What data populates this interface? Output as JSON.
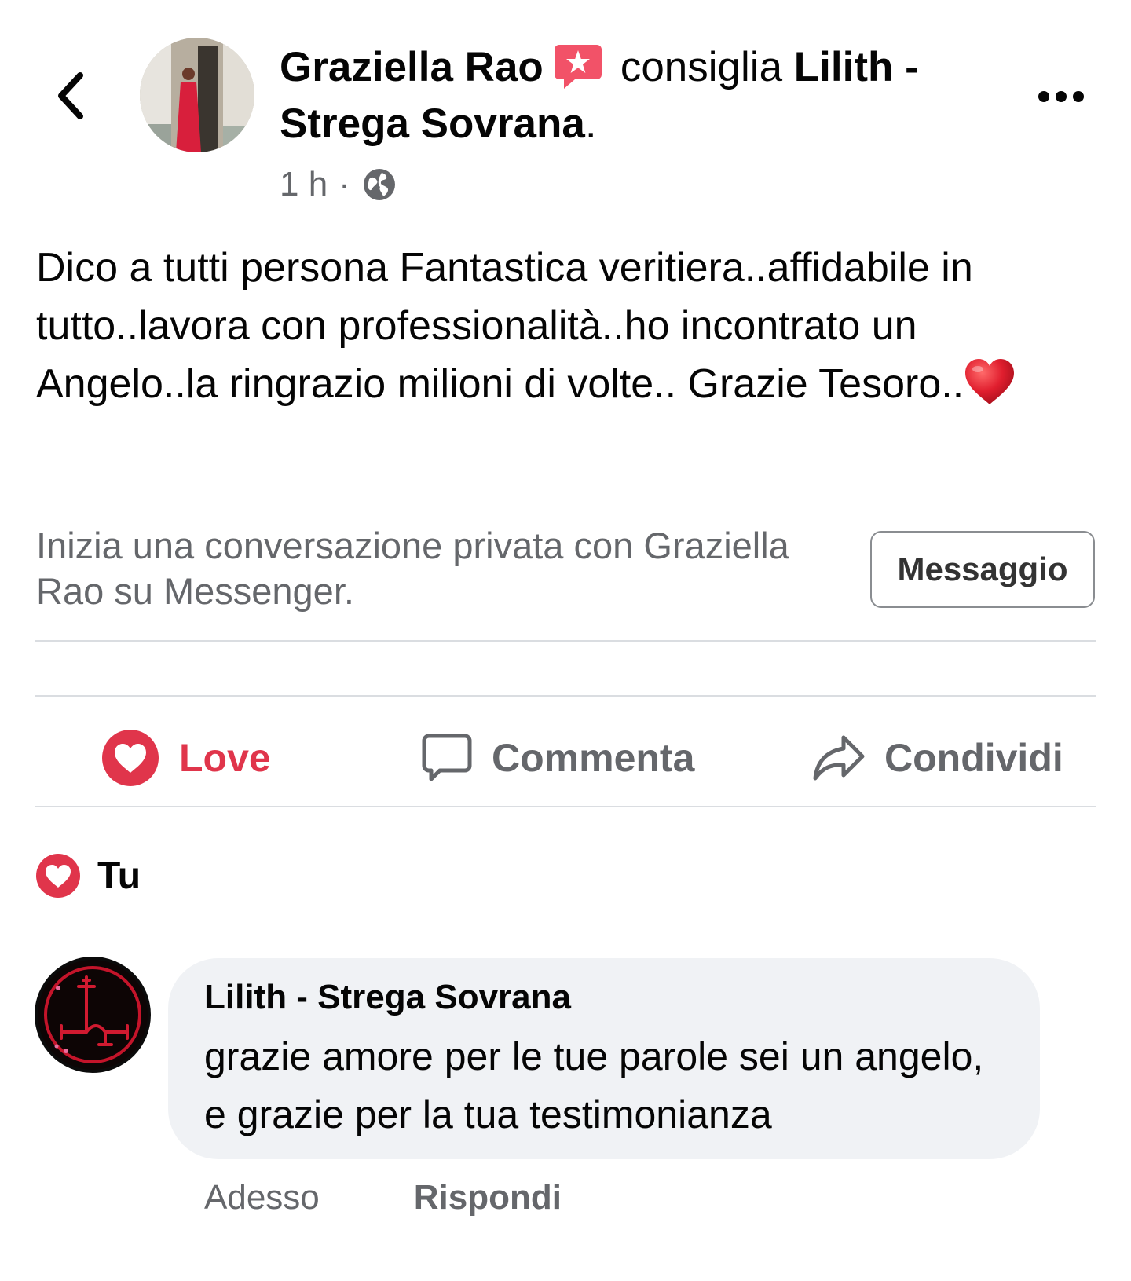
{
  "header": {
    "author_name": "Graziella Rao",
    "verb": "consiglia",
    "page_name_part1": "Lilith -",
    "page_name_part2": "Strega Sovrana",
    "period": ".",
    "time": "1 h",
    "separator": "·",
    "privacy_icon": "globe-icon",
    "recommend_icon": "recommendation-icon",
    "more_icon": "more-options-icon"
  },
  "post": {
    "text": "Dico a tutti persona Fantastica veritiera..affidabile in tutto..lavora con professionalità..ho incontrato un Angelo..la ringrazio milioni di volte.. Grazie Tesoro..",
    "trailing_emoji": "red-heart-emoji"
  },
  "messenger_prompt": {
    "text": "Inizia una conversazione privata con Graziella Rao su Messenger.",
    "button_label": "Messaggio"
  },
  "actions": {
    "love": "Love",
    "comment": "Commenta",
    "share": "Condividi"
  },
  "reactions": {
    "label": "Tu"
  },
  "comment": {
    "author": "Lilith - Strega Sovrana",
    "text": "grazie amore per le tue parole sei un angelo, e grazie per la tua testimonianza",
    "time": "Adesso",
    "reply": "Rispondi"
  },
  "colors": {
    "love_red": "#e0354b",
    "secondary_text": "#65676b",
    "bubble_bg": "#f0f2f5",
    "divider": "#dadde1",
    "badge_pink": "#f25268"
  }
}
